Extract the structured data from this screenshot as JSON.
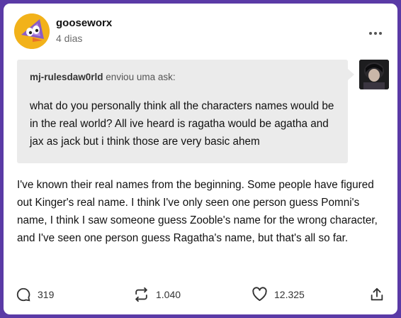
{
  "post": {
    "author": "gooseworx",
    "timestamp": "4 dias",
    "ask": {
      "asker": "mj-rulesdaw0rld",
      "action": "enviou uma ask:",
      "question": "what do you personally think all the characters names would be in the real world? All ive heard is ragatha would be agatha and jax as jack but i think those are very basic ahem"
    },
    "answer": "I've known their real names from the beginning. Some people have figured out Kinger's real name. I think I've only seen one person guess Pomni's name, I think I saw someone guess Zooble's name for the wrong character, and I've seen one person guess Ragatha's name, but that's all so far."
  },
  "footer": {
    "comments": "319",
    "reblogs": "1.040",
    "likes": "12.325"
  },
  "icons": {
    "more": "more-horizontal-icon",
    "comment": "comment-icon",
    "reblog": "reblog-icon",
    "like": "heart-icon",
    "share": "share-icon"
  },
  "colors": {
    "background": "#5a3aa6",
    "card": "#ffffff",
    "ask_box": "#ebebeb",
    "avatar_bg": "#f2b21a"
  }
}
